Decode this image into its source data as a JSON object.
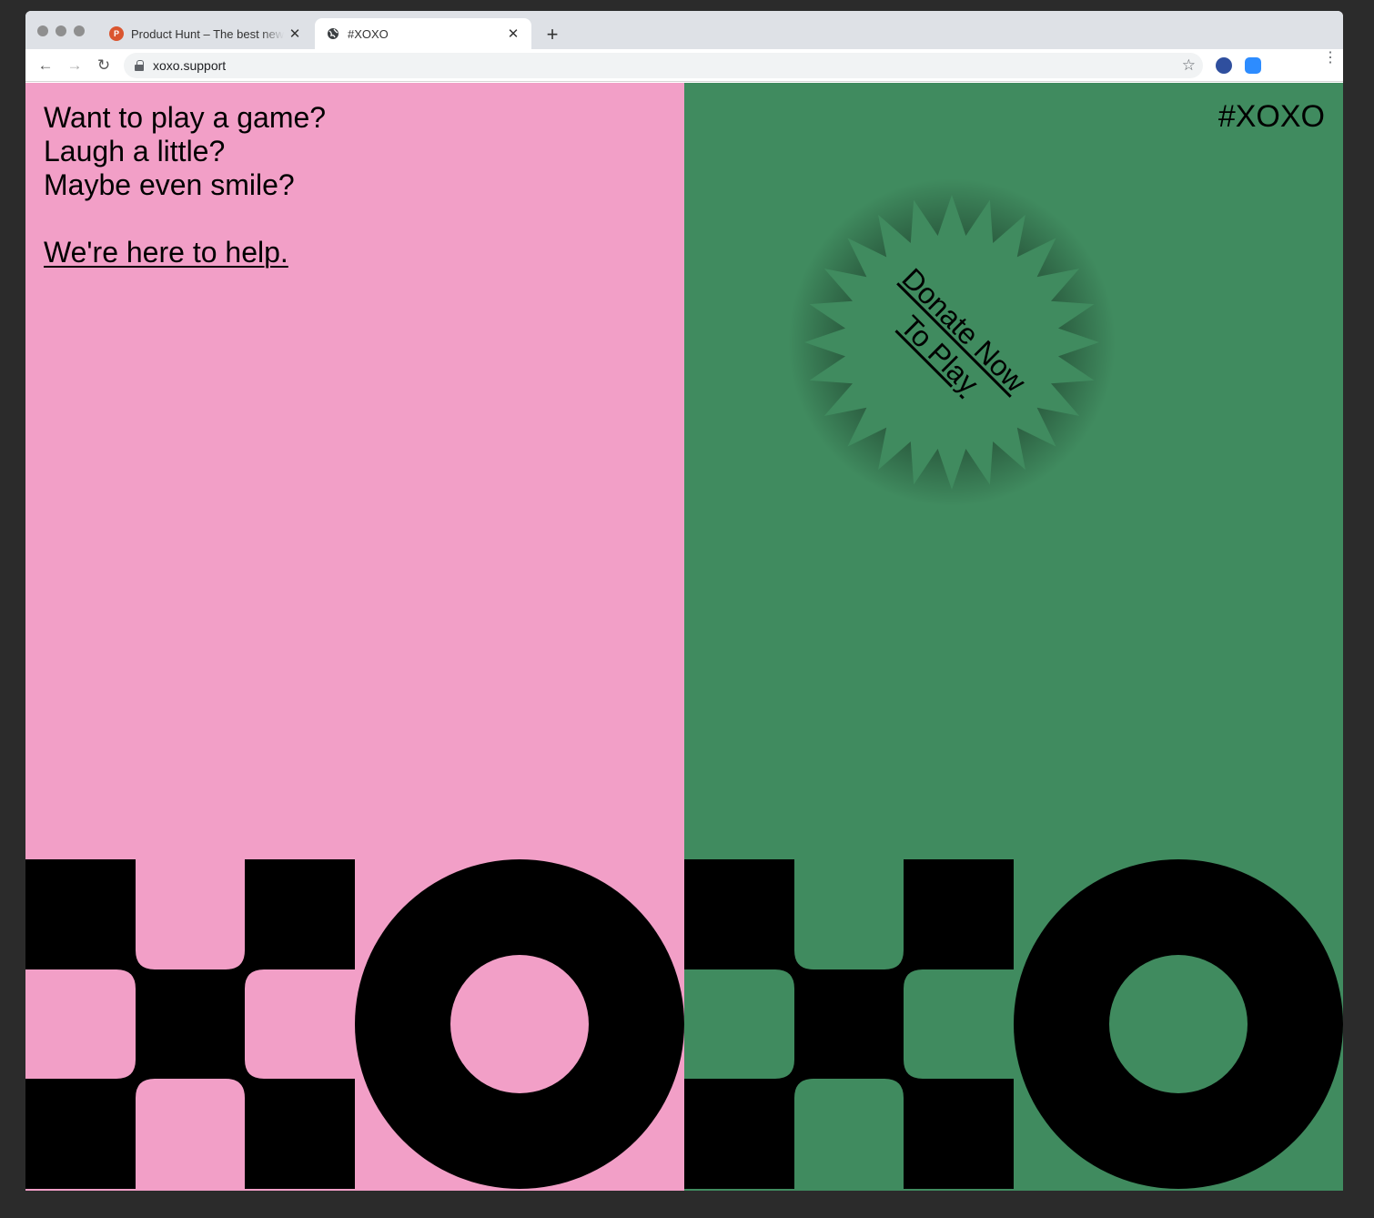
{
  "browser": {
    "tabs": [
      {
        "title": "Product Hunt – The best new products in tech.",
        "favicon": "P",
        "active": false
      },
      {
        "title": "#XOXO",
        "favicon": "globe-icon",
        "active": true
      }
    ],
    "new_tab_label": "+",
    "url": "xoxo.support"
  },
  "left": {
    "lines": [
      "Want to play a game?",
      "Laugh a little?",
      "Maybe even smile?"
    ],
    "cta_link": "We're here to help.",
    "background": "#f29fc7"
  },
  "right": {
    "brand": "#XOXO",
    "donate_line1": "Donate Now",
    "donate_line2": "To Play",
    "background": "#408b5f"
  }
}
